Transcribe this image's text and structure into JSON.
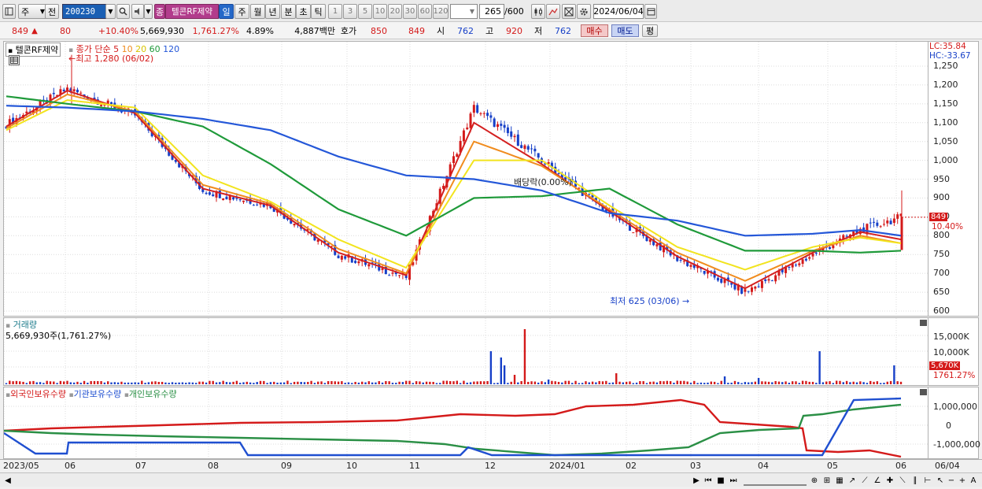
{
  "toolbar": {
    "type_select": "주",
    "prev_label": "전",
    "code": "200230",
    "stock_badge": "종",
    "stock_name": "텔콘RF제약",
    "period_tabs": [
      "일",
      "주",
      "월",
      "년",
      "분",
      "초",
      "틱"
    ],
    "period_selected": "일",
    "minute_buttons": [
      "1",
      "3",
      "5",
      "10",
      "20",
      "30",
      "60",
      "120"
    ],
    "count_value": "265",
    "count_total": "/600",
    "date": "2024/06/04"
  },
  "quote": {
    "price": "849",
    "change_arrow": "▲",
    "change": "80",
    "change_pct": "+10.40%",
    "volume": "5,669,930",
    "volume_ratio": "1,761.27%",
    "turnover": "4.89%",
    "amount": "4,887백만",
    "hoga_label": "호가",
    "ask": "850",
    "bid": "849",
    "open_label": "시",
    "open": "762",
    "high_label": "고",
    "high": "920",
    "low_label": "저",
    "low": "762",
    "buy_label": "매수",
    "sell_label": "매도",
    "eval_label": "평"
  },
  "main_chart": {
    "legend_title": "텔콘RF제약",
    "legend_ma_label": "종가 단순",
    "ma_periods": [
      "5",
      "10",
      "20",
      "60",
      "120"
    ],
    "ma_colors": [
      "#d42020",
      "#f08c1e",
      "#f2e41e",
      "#1f9a3a",
      "#2457d8"
    ],
    "lc_label": "LC:35.84",
    "hc_label": "HC:-33.67",
    "high_mark": "최고 1,280 (06/02)",
    "low_mark": "최저 625 (03/06)",
    "dividend_mark": "배당락(0.00%)",
    "yticks": [
      "1,250",
      "1,200",
      "1,150",
      "1,100",
      "1,050",
      "1,000",
      "950",
      "900",
      "850",
      "800",
      "750",
      "700",
      "650",
      "600"
    ],
    "last_price_tag": "849",
    "last_pct_tag": "10.40%"
  },
  "volume_chart": {
    "title": "거래량",
    "value_text": "5,669,930주(1,761.27%)",
    "yticks": [
      "15,000K",
      "10,000K",
      "5,000K"
    ],
    "last_tag": "5,670K",
    "last_pct_tag": "1761.27%"
  },
  "holding_chart": {
    "legend": [
      "외국인보유수량",
      "기관보유수량",
      "개인보유수량"
    ],
    "legend_colors": [
      "#d41a1a",
      "#1f4fd0",
      "#2a8f45"
    ],
    "yticks": [
      "1,000,000",
      "0",
      "-1,000,000"
    ]
  },
  "xaxis": [
    "2023/05",
    "06",
    "07",
    "08",
    "09",
    "10",
    "11",
    "12",
    "2024/01",
    "02",
    "03",
    "04",
    "05",
    "06",
    "06/04"
  ],
  "chart_data": {
    "type": "line",
    "title": "텔콘RF제약",
    "x": [
      "2023/05",
      "06",
      "07",
      "08",
      "09",
      "10",
      "11",
      "12",
      "2024/01",
      "02",
      "03",
      "04",
      "05",
      "06"
    ],
    "series": [
      {
        "name": "종가",
        "values": [
          1095,
          1190,
          1120,
          920,
          880,
          750,
          690,
          1140,
          1000,
          860,
          740,
          650,
          750,
          815,
          849
        ]
      },
      {
        "name": "5",
        "values": [
          1090,
          1185,
          1125,
          925,
          880,
          755,
          695,
          1100,
          990,
          865,
          745,
          660,
          755,
          810,
          790
        ]
      },
      {
        "name": "10",
        "values": [
          1085,
          1175,
          1130,
          935,
          885,
          765,
          700,
          1050,
          985,
          870,
          755,
          680,
          760,
          800,
          780
        ]
      },
      {
        "name": "20",
        "values": [
          1080,
          1160,
          1140,
          960,
          890,
          790,
          715,
          1000,
          1000,
          880,
          770,
          710,
          770,
          795,
          780
        ]
      },
      {
        "name": "60",
        "values": [
          1170,
          1150,
          1130,
          1090,
          990,
          870,
          800,
          900,
          905,
          925,
          830,
          760,
          760,
          755,
          760
        ]
      },
      {
        "name": "120",
        "values": [
          1145,
          1140,
          1130,
          1110,
          1080,
          1010,
          960,
          950,
          920,
          860,
          840,
          800,
          805,
          815,
          800
        ]
      }
    ],
    "ylim": [
      600,
      1280
    ],
    "annotations": [
      "최고 1,280 (06/02)",
      "최저 625 (03/06)",
      "배당락(0.00%)"
    ]
  }
}
